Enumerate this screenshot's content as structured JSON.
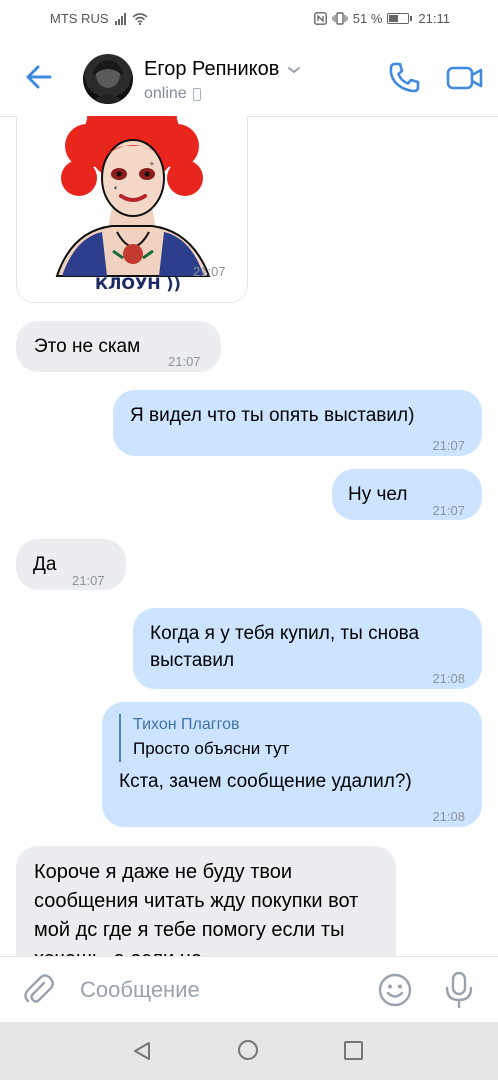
{
  "status_bar": {
    "carrier": "MTS RUS",
    "battery": "51 %",
    "battery_level": 0.51,
    "time": "21:11"
  },
  "header": {
    "contact_name": "Егор Репников",
    "presence": "online"
  },
  "sticker": {
    "caption": "КЛОУН ))",
    "time": "21:07"
  },
  "messages": [
    {
      "side": "in",
      "text": "Это не скам",
      "time": "21:07"
    },
    {
      "side": "out",
      "text": "Я видел что ты опять выставил)",
      "time": "21:07"
    },
    {
      "side": "out",
      "text": "Ну чел",
      "time": "21:07"
    },
    {
      "side": "in",
      "text": "Да",
      "time": "21:07"
    },
    {
      "side": "out",
      "text": "Когда я у тебя купил, ты снова выставил",
      "time": "21:08"
    },
    {
      "side": "out",
      "reply_author": "Тихон Плаггов",
      "reply_text": "Просто объясни тут",
      "text": "Кста, зачем сообщение удалил?)",
      "time": "21:08"
    },
    {
      "side": "in",
      "text": "Короче я даже не буду твои сообщения читать жду покупки вот мой дс где я тебе помогу если ты хочешь, а если не"
    }
  ],
  "composer": {
    "placeholder": "Сообщение"
  },
  "icons": {
    "back": "arrow-left-icon",
    "call": "phone-icon",
    "video": "video-camera-icon",
    "attach": "paperclip-icon",
    "emoji": "smile-icon",
    "mic": "microphone-icon"
  },
  "colors": {
    "accent": "#3f8ae0",
    "incoming_bubble": "#ebedf0",
    "outgoing_bubble": "#cce4ff"
  }
}
